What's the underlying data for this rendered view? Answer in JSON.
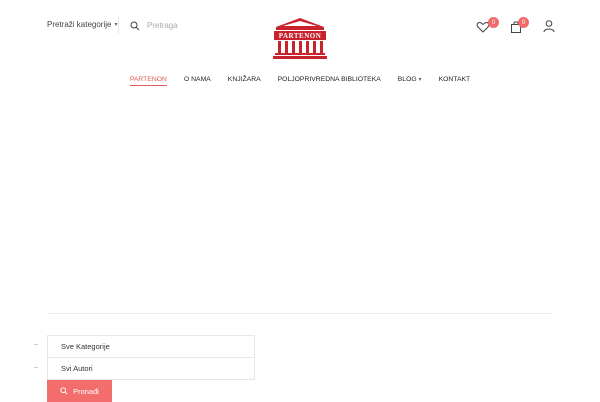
{
  "header": {
    "category_label": "Pretraži kategorije",
    "search_placeholder": "Pretraga",
    "logo_text": "PARTENON",
    "wishlist_count": "0",
    "cart_count": "0"
  },
  "nav": {
    "items": [
      {
        "label": "PARTENON"
      },
      {
        "label": "O NAMA"
      },
      {
        "label": "KNJIŽARA"
      },
      {
        "label": "POLJOPRIVREDNA BIBLIOTEKA"
      },
      {
        "label": "BLOG"
      },
      {
        "label": "KONTAKT"
      }
    ]
  },
  "filters": {
    "category": "Sve Kategorije",
    "author": "Svi Autori",
    "find_button": "Pronađi"
  },
  "colors": {
    "accent": "#f36d6d",
    "logo_red": "#c8232c"
  }
}
